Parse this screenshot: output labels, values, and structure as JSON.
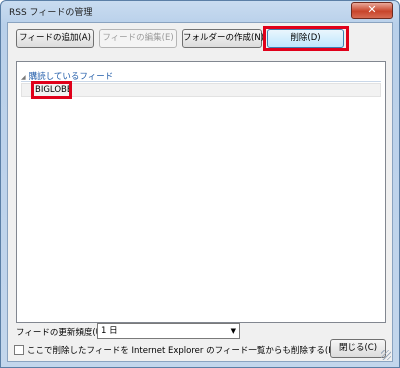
{
  "window": {
    "title": "RSS フィードの管理",
    "close_glyph": "✕"
  },
  "toolbar": {
    "add_feed": "フィードの追加(A)",
    "edit_feed": "フィードの編集(E)",
    "create_folder": "フォルダーの作成(N)",
    "delete": "削除(D)"
  },
  "feeds": {
    "group_label": "購読しているフィード",
    "items": [
      {
        "label": "BIGLOBE"
      }
    ]
  },
  "update_frequency": {
    "label": "フィードの更新頻度(U):",
    "value": "1 日"
  },
  "delete_from_ie": {
    "label": "ここで削除したフィードを Internet Explorer のフィード一覧からも削除する(F)",
    "checked": false
  },
  "footer": {
    "close_label": "閉じる(C)"
  },
  "colors": {
    "highlight": "#e0001a",
    "group_text": "#1e5aa8"
  }
}
